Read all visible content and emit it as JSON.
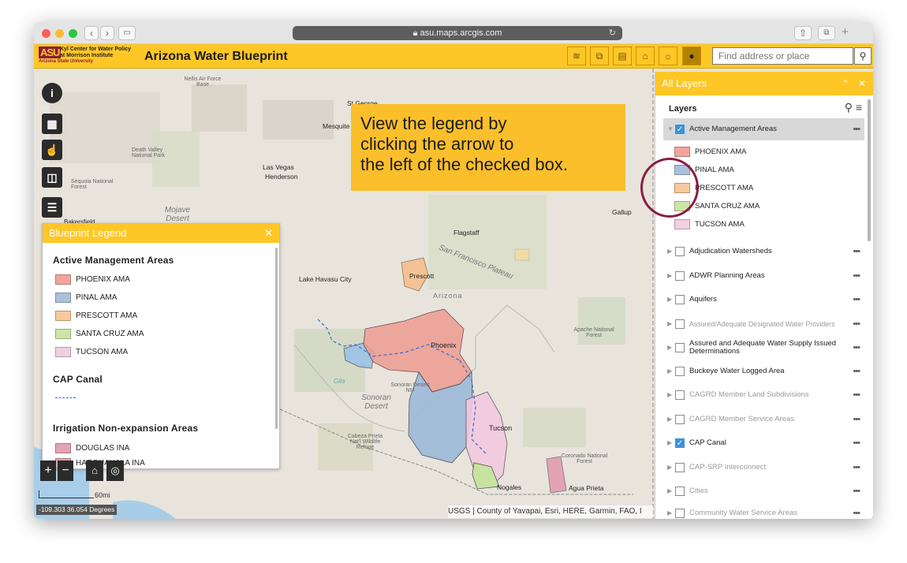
{
  "browser": {
    "url": "asu.maps.arcgis.com"
  },
  "app": {
    "logo_mark": "ASU",
    "logo_line1": "Kyl Center for Water Policy",
    "logo_line2": "at Morrison Institute",
    "logo_sub": "Arizona State University",
    "title": "Arizona Water Blueprint",
    "search_placeholder": "Find address or place"
  },
  "map_labels": {
    "st_george": "St George",
    "mesquite": "Mesquite",
    "nellis": "Nellis Air Force Base",
    "death_valley": "Death Valley National Park",
    "las_vegas": "Las Vegas",
    "henderson": "Henderson",
    "sequoia": "Sequoia National Forest",
    "mojave": "Mojave Desert",
    "bakersfield": "Bakersfield",
    "flagstaff": "Flagstaff",
    "san_francisco_plateau": "San Francisco Plateau",
    "lake_havasu": "Lake Havasu City",
    "prescott": "Prescott",
    "arizona": "Arizona",
    "phoenix": "Phoenix",
    "apache": "Apache National Forest",
    "gallup": "Gallup",
    "sonoran_nm": "Sonoran Desert NM",
    "sonoran_desert": "Sonoran Desert",
    "cabeza": "Cabeza Prieta Nat'l Wildlife Refuge",
    "tucson": "Tucson",
    "coronado": "Coronado National Forest",
    "nogales": "Nogales",
    "agua_prieta": "Agua Prieta",
    "gila": "Gila"
  },
  "annotation": {
    "line1": "View the legend by",
    "line2": "clicking the arrow to",
    "line3": "the left of the checked box."
  },
  "legend": {
    "title": "Blueprint Legend",
    "sections": [
      "Active Management Areas",
      "CAP Canal",
      "Irrigation Non-expansion Areas"
    ],
    "ama_items": [
      {
        "label": "PHOENIX AMA",
        "color": "#f2a49a"
      },
      {
        "label": "PINAL AMA",
        "color": "#a9c1dd"
      },
      {
        "label": "PRESCOTT AMA",
        "color": "#f8c99a"
      },
      {
        "label": "SANTA CRUZ AMA",
        "color": "#cfe5a8"
      },
      {
        "label": "TUCSON AMA",
        "color": "#f2cfe0"
      }
    ],
    "ina_items": [
      {
        "label": "DOUGLAS INA",
        "color": "#e3a3b3"
      },
      {
        "label": "HARQUAHALA INA",
        "color": "#d9a7b3"
      }
    ]
  },
  "map_ui": {
    "coords": "-109.303 36.054 Degrees",
    "scale": "60mi",
    "attribution": "USGS | County of Yavapai, Esri, HERE, Garmin, FAO, I"
  },
  "layers": {
    "panel_title": "All Layers",
    "header": "Layers",
    "rows": [
      {
        "label": "Active Management Areas",
        "checked": true,
        "dim": false
      },
      {
        "label": "Adjudication Watersheds",
        "checked": false,
        "dim": false
      },
      {
        "label": "ADWR Planning Areas",
        "checked": false,
        "dim": false
      },
      {
        "label": "Aquifers",
        "checked": false,
        "dim": false
      },
      {
        "label": "Assured/Adequate Designated Water Providers",
        "checked": false,
        "dim": true
      },
      {
        "label": "Assured and Adequate Water Supply Issued Determinations",
        "checked": false,
        "dim": false
      },
      {
        "label": "Buckeye Water Logged Area",
        "checked": false,
        "dim": false
      },
      {
        "label": "CAGRD Member Land Subdivisions",
        "checked": false,
        "dim": true
      },
      {
        "label": "CAGRD Member Service Areas",
        "checked": false,
        "dim": true
      },
      {
        "label": "CAP Canal",
        "checked": true,
        "dim": false
      },
      {
        "label": "CAP-SRP Interconnect",
        "checked": false,
        "dim": true
      },
      {
        "label": "Cities",
        "checked": false,
        "dim": true
      },
      {
        "label": "Community Water Service Areas",
        "checked": false,
        "dim": true
      }
    ],
    "ama_sub": [
      "PHOENIX AMA",
      "PINAL AMA",
      "PRESCOTT AMA",
      "SANTA CRUZ AMA",
      "TUCSON AMA"
    ]
  }
}
